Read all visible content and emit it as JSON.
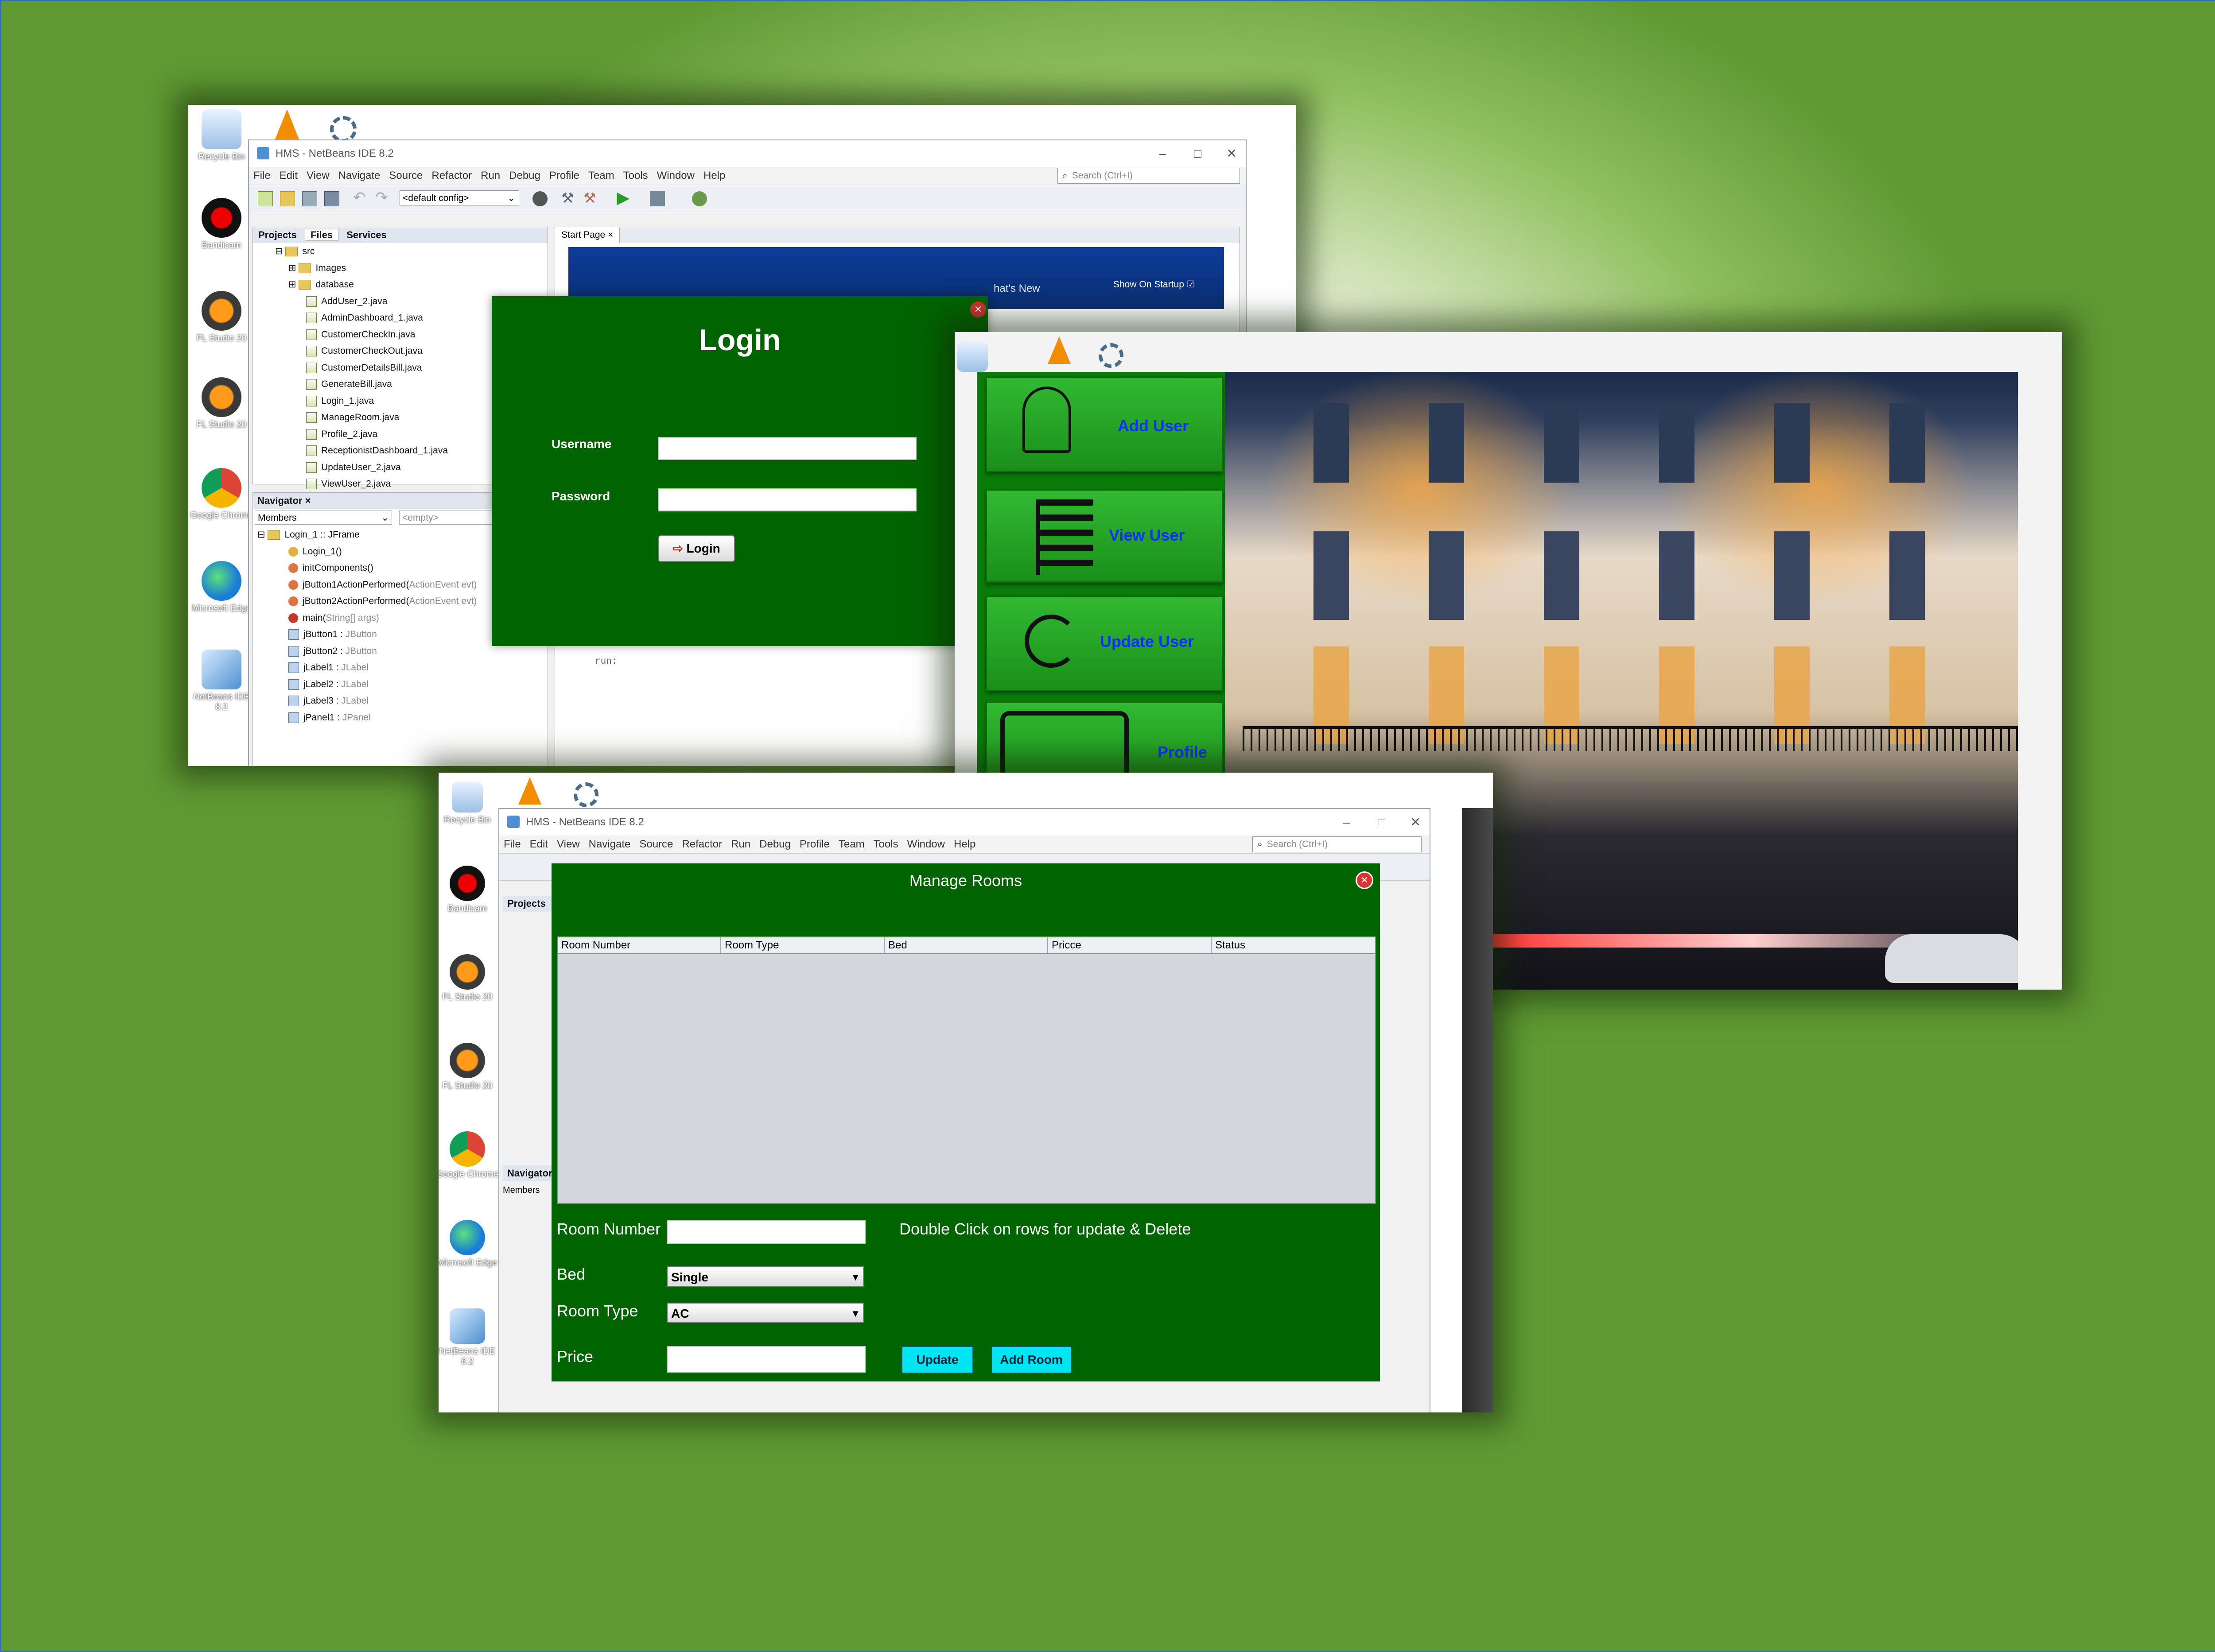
{
  "desktop": {
    "icons_left": [
      "Recycle Bin",
      "Bandicam",
      "FL Studio 20",
      "FL Studio 20",
      "Google Chrome",
      "Microsoft Edge",
      "NetBeans IDE 8.2"
    ],
    "icons_top_right": [
      "Recycle Bin"
    ],
    "icons_mid": [
      "Recycle Bin",
      "Bandicam",
      "FL Studio 20",
      "FL Studio 20",
      "Google Chrome",
      "Microsoft Edge",
      "NetBeans IDE 8.2"
    ]
  },
  "ide1": {
    "title": "HMS - NetBeans IDE 8.2",
    "menu": [
      "File",
      "Edit",
      "View",
      "Navigate",
      "Source",
      "Refactor",
      "Run",
      "Debug",
      "Profile",
      "Team",
      "Tools",
      "Window",
      "Help"
    ],
    "search_placeholder": "Search (Ctrl+I)",
    "config": "<default config>",
    "tabs": [
      "Projects",
      "Files",
      "Services"
    ],
    "files_root": "src",
    "folders": [
      "Images",
      "database"
    ],
    "files": [
      "AddUser_2.java",
      "AdminDashboard_1.java",
      "CustomerCheckIn.java",
      "CustomerCheckOut.java",
      "CustomerDetailsBill.java",
      "GenerateBill.java",
      "Login_1.java",
      "ManageRoom.java",
      "Profile_2.java",
      "ReceptionistDashboard_1.java",
      "UpdateUser_2.java",
      "ViewUser_2.java"
    ],
    "navigator": {
      "tab": "Navigator",
      "filter": "Members",
      "filter2": "<empty>",
      "root": "Login_1 :: JFrame",
      "members": [
        {
          "name": "Login_1()",
          "type": ""
        },
        {
          "name": "initComponents()",
          "type": ""
        },
        {
          "name": "jButton1ActionPerformed(",
          "type": "ActionEvent evt)"
        },
        {
          "name": "jButton2ActionPerformed(",
          "type": "ActionEvent evt)"
        },
        {
          "name": "main(",
          "type": "String[] args)"
        },
        {
          "name": "jButton1 : ",
          "type": "JButton"
        },
        {
          "name": "jButton2 : ",
          "type": "JButton"
        },
        {
          "name": "jLabel1 : ",
          "type": "JLabel"
        },
        {
          "name": "jLabel2 : ",
          "type": "JLabel"
        },
        {
          "name": "jLabel3 : ",
          "type": "JLabel"
        },
        {
          "name": "jPanel1 : ",
          "type": "JPanel"
        }
      ]
    },
    "editor_tab": "Start Page",
    "start_page": {
      "whats_new": "hat's New",
      "show_on_startup": "Show On Startup"
    },
    "output": "run:"
  },
  "login": {
    "title": "Login",
    "username_label": "Username",
    "password_label": "Password",
    "button": "Login"
  },
  "dashboard": {
    "tiles": [
      "Add User",
      "View User",
      "Update User",
      "Profile"
    ]
  },
  "ide2": {
    "title": "HMS - NetBeans IDE 8.2",
    "menu": [
      "File",
      "Edit",
      "View",
      "Navigate",
      "Source",
      "Refactor",
      "Run",
      "Debug",
      "Profile",
      "Team",
      "Tools",
      "Window",
      "Help"
    ],
    "search_placeholder": "Search (Ctrl+I)",
    "projects_tab": "Projects",
    "navigator_tab": "Navigator",
    "members": "Members"
  },
  "manage_rooms": {
    "title": "Manage Rooms",
    "columns": [
      "Room Number",
      "Room Type",
      "Bed",
      "Pricce",
      "Status"
    ],
    "room_number_label": "Room Number",
    "hint": "Double Click on rows for update & Delete",
    "bed_label": "Bed",
    "bed_value": "Single",
    "room_type_label": "Room Type",
    "room_type_value": "AC",
    "price_label": "Price",
    "update_button": "Update",
    "add_button": "Add Room"
  },
  "colors": {
    "form_green": "#006400",
    "tile_text": "#1030ff",
    "button_cyan": "#00e5f2"
  }
}
